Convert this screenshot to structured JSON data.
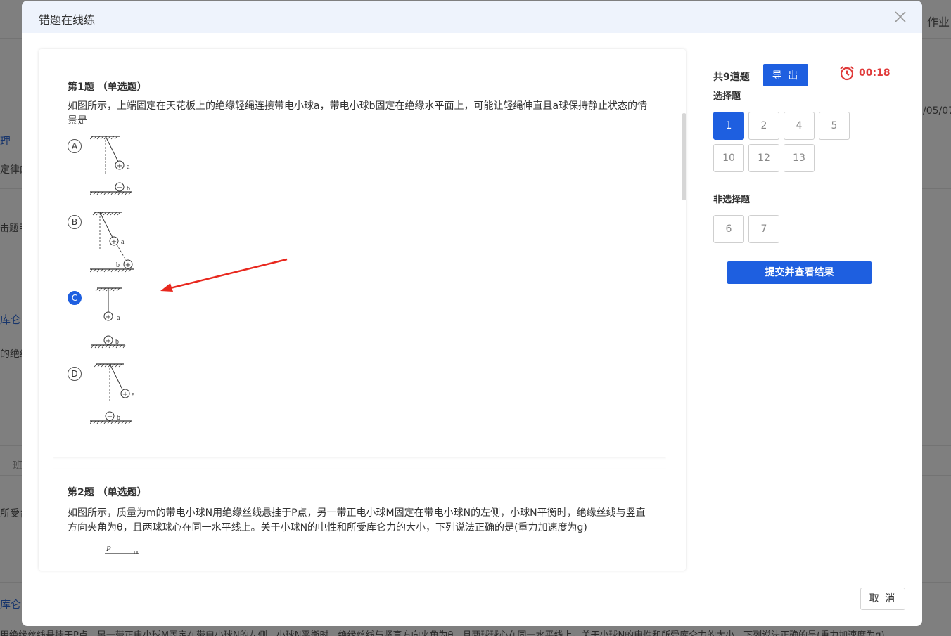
{
  "background": {
    "top_right_text": "作业",
    "date_text": "/05/07",
    "side_texts": [
      "理",
      "定律的",
      "击题目",
      "库仑",
      "的绝缘",
      "班",
      "所受台",
      "库仑"
    ],
    "bottom_text": "用绝缘丝线悬挂于P点，另一带正电小球M固定在带电小球N的左侧，小球N平衡时，绝缘丝线与竖直方向夹角为θ，且两球球心在同一水平线上。关于小球N的电性和所受库仑力的大小，下列说法正确的是(重力加速度为g)"
  },
  "modal": {
    "title": "错题在线练",
    "cancel_label": "取 消"
  },
  "questions": [
    {
      "title": "第1题 （单选题）",
      "text": "如图所示，上端固定在天花板上的绝缘轻绳连接带电小球a，带电小球b固定在绝缘水平面上，可能让轻绳伸直且a球保持静止状态的情景是",
      "options": [
        {
          "letter": "A",
          "ball_a": "+",
          "ball_b": "−",
          "label_a": "a",
          "label_b": "b"
        },
        {
          "letter": "B",
          "ball_a": "+",
          "ball_b": "+",
          "label_a": "a",
          "label_b": "b"
        },
        {
          "letter": "C",
          "ball_a": "+",
          "ball_b": "+",
          "label_a": "a",
          "label_b": "b",
          "selected": true
        },
        {
          "letter": "D",
          "ball_a": "+",
          "ball_b": "−",
          "label_a": "a",
          "label_b": "b"
        }
      ]
    },
    {
      "title": "第2题 （单选题）",
      "text": "如图所示，质量为m的带电小球N用绝缘丝线悬挂于P点，另一带正电小球M固定在带电小球N的左侧，小球N平衡时，绝缘丝线与竖直方向夹角为θ，且两球球心在同一水平线上。关于小球N的电性和所受库仑力的大小，下列说法正确的是(重力加速度为g)",
      "figure_label": "P"
    }
  ],
  "side_panel": {
    "count_label": "共9道题",
    "export_label": "导 出",
    "timer": "00:18",
    "choice_section": "选择题",
    "choice_numbers": [
      "1",
      "2",
      "4",
      "5",
      "10",
      "12",
      "13"
    ],
    "active_number": "1",
    "non_choice_section": "非选择题",
    "non_choice_numbers": [
      "6",
      "7"
    ],
    "submit_label": "提交并查看结果"
  },
  "colors": {
    "primary": "#1e5fe0",
    "timer_red": "#e03b3b",
    "header_bg": "#eef3fc",
    "arrow_red": "#e8281e"
  }
}
